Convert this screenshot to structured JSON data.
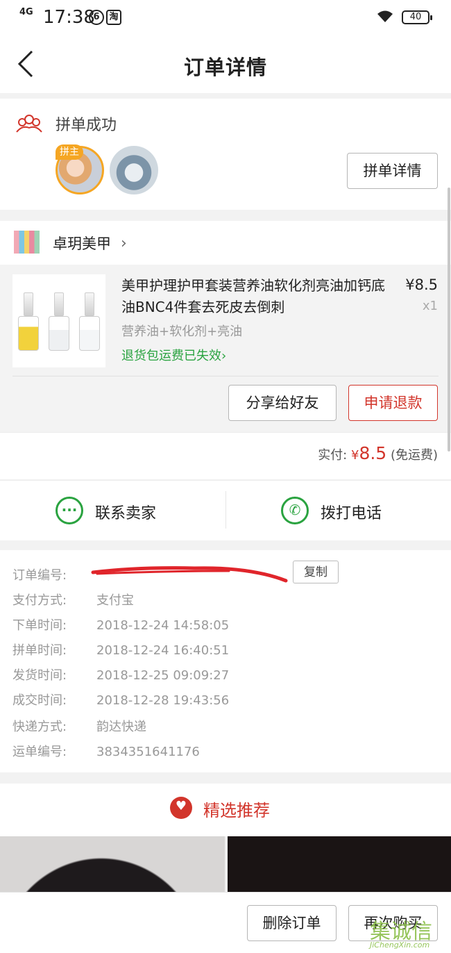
{
  "status_bar": {
    "network": "4G",
    "time": "17:38",
    "battery": "40"
  },
  "header": {
    "title": "订单详情"
  },
  "group": {
    "status": "拼单成功",
    "host_badge": "拼主",
    "detail_button": "拼单详情"
  },
  "store": {
    "name": "卓玥美甲"
  },
  "product": {
    "title": "美甲护理护甲套装营养油软化剂亮油加钙底油BNC4件套去死皮去倒刺",
    "price": "¥8.5",
    "quantity": "x1",
    "spec": "营养油+软化剂+亮油",
    "return_notice": "退货包运费已失效",
    "return_chevron": "›",
    "share_button": "分享给好友",
    "refund_button": "申请退款"
  },
  "payment": {
    "label": "实付:",
    "currency": "¥",
    "amount": "8.5",
    "shipping": "(免运费)"
  },
  "contact": {
    "seller": "联系卖家",
    "phone": "拨打电话"
  },
  "order_info": {
    "copy_button": "复制",
    "rows": [
      {
        "key": "订单编号:",
        "value": ""
      },
      {
        "key": "支付方式:",
        "value": "支付宝"
      },
      {
        "key": "下单时间:",
        "value": "2018-12-24 14:58:05"
      },
      {
        "key": "拼单时间:",
        "value": "2018-12-24 16:40:51"
      },
      {
        "key": "发货时间:",
        "value": "2018-12-25 09:09:27"
      },
      {
        "key": "成交时间:",
        "value": "2018-12-28 19:43:56"
      },
      {
        "key": "快递方式:",
        "value": "韵达快递"
      },
      {
        "key": "运单编号:",
        "value": "3834351641176"
      }
    ]
  },
  "recommend": {
    "title": "精选推荐"
  },
  "bottom_bar": {
    "delete_button": "删除订单",
    "rebuy_button": "再次购买"
  },
  "watermark": {
    "main": "集诚信",
    "sub": "JiChengXin.com"
  },
  "colors": {
    "accent_red": "#d2352b",
    "green": "#2aa340",
    "host_badge": "#f5a623"
  }
}
